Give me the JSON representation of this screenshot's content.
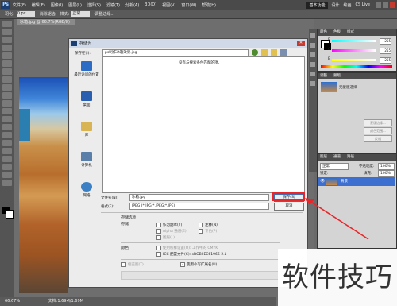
{
  "app": {
    "logo": "Ps",
    "zoom": "66.7%"
  },
  "menu": [
    "文件(F)",
    "编辑(E)",
    "图像(I)",
    "图层(L)",
    "选择(S)",
    "滤镜(T)",
    "分析(A)",
    "3D(D)",
    "视图(V)",
    "窗口(W)",
    "帮助(H)"
  ],
  "workspace": {
    "active": "基本功能",
    "items": [
      "设计",
      "绘画"
    ],
    "cslive": "CS Live"
  },
  "options_bar": {
    "feather_label": "羽化:",
    "feather_value": "0 px",
    "antialias": "消除锯齿",
    "style_label": "样式:",
    "style_value": "正常",
    "refine": "调整边缘..."
  },
  "doc_tab": "冰箱.jpg @ 66.7%(RGB/8)",
  "status_bar": {
    "zoom": "66.67%",
    "doc": "文档:1.69M/1.69M"
  },
  "right_panel": {
    "color_tabs": [
      "颜色",
      "色板",
      "样式"
    ],
    "r": {
      "label": "R",
      "value": "255"
    },
    "g": {
      "label": "G",
      "value": "255"
    },
    "b": {
      "label": "B",
      "value": "255"
    },
    "adjust_tabs": [
      "调整",
      "蒙版"
    ],
    "adjust_text": "无蒙版选择",
    "mask_buttons": [
      "蒙版边缘...",
      "颜色范围...",
      "反相"
    ],
    "layers_tabs": [
      "图层",
      "通道",
      "路径"
    ],
    "blend_mode": "正常",
    "opacity_label": "不透明度:",
    "opacity_value": "100%",
    "lock_label": "锁定:",
    "fill_label": "填充:",
    "fill_value": "100%",
    "layer_name": "背景"
  },
  "dialog": {
    "title": "存储为",
    "close": "✕",
    "save_in_label": "保存在(I):",
    "save_in_value": "ps制作冰箱效果.jpg",
    "empty_message": "没有与搜索条件匹配的项。",
    "places": [
      "最近访问的位置",
      "桌面",
      "库",
      "计算机",
      "网络"
    ],
    "filename_label": "文件名(N):",
    "filename_value": "冰箱.jpg",
    "format_label": "格式(F):",
    "format_value": "JPEG (*.JPG;*.JPEG;*.JPE)",
    "save_button": "保存(S)",
    "cancel_button": "取消",
    "options_header": "存储选项",
    "save_label": "存储:",
    "as_copy": "作为副本(Y)",
    "alpha": "Alpha 通道(E)",
    "layers": "图层(L)",
    "notes": "注释(N)",
    "spot": "专色(P)",
    "color_label": "颜色:",
    "use_proof": "使用校样设置(O): 工作中的 CMYK",
    "icc": "ICC 配置文件(C): sRGB IEC61966-2.1",
    "thumbnail": "缩览图(T)",
    "lowercase": "使用小写扩展名(U)"
  },
  "watermark": "软件技巧",
  "colors": {
    "highlight": "#e8262a",
    "ps_blue": "#1b3f73"
  }
}
